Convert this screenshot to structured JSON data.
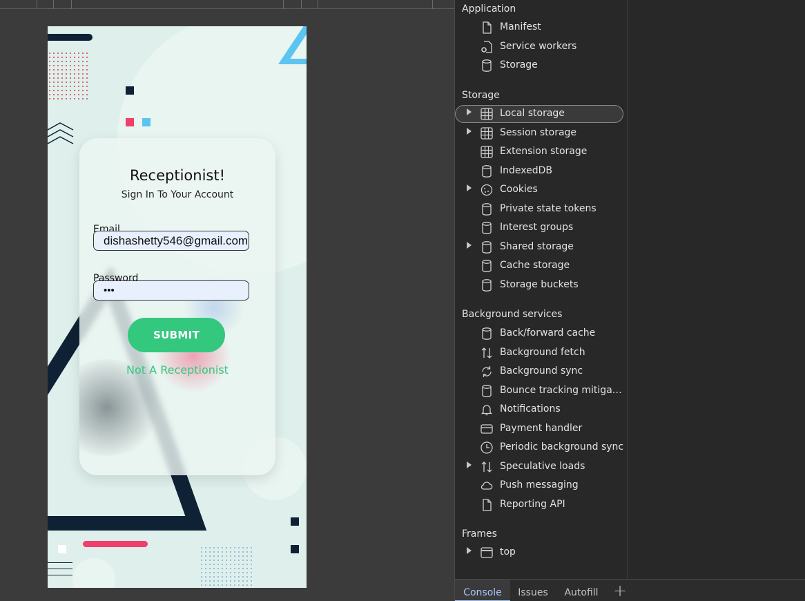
{
  "login_card": {
    "title": "Receptionist!",
    "subtitle": "Sign In To Your Account",
    "email_label": "Email",
    "email_value": "dishashetty546@gmail.com",
    "password_label": "Password",
    "password_value": "•••",
    "submit_label": "SUBMIT",
    "alt_link": "Not A Receptionist"
  },
  "colors": {
    "accent_green": "#33c87e",
    "navy": "#0f2235",
    "pink": "#ef3f6a",
    "sky": "#5bc4ef",
    "devtools_bg": "#282828"
  },
  "devtools": {
    "sections": {
      "application": "Application",
      "storage": "Storage",
      "background_services": "Background services",
      "frames": "Frames"
    },
    "application_items": [
      {
        "label": "Manifest",
        "icon": "file-icon"
      },
      {
        "label": "Service workers",
        "icon": "gear-file-icon"
      },
      {
        "label": "Storage",
        "icon": "database-icon"
      }
    ],
    "storage_items": [
      {
        "label": "Local storage",
        "icon": "grid-icon",
        "expandable": true,
        "selected": true
      },
      {
        "label": "Session storage",
        "icon": "grid-icon",
        "expandable": true
      },
      {
        "label": "Extension storage",
        "icon": "grid-icon"
      },
      {
        "label": "IndexedDB",
        "icon": "database-icon"
      },
      {
        "label": "Cookies",
        "icon": "cookie-icon",
        "expandable": true
      },
      {
        "label": "Private state tokens",
        "icon": "database-icon"
      },
      {
        "label": "Interest groups",
        "icon": "database-icon"
      },
      {
        "label": "Shared storage",
        "icon": "database-icon",
        "expandable": true
      },
      {
        "label": "Cache storage",
        "icon": "database-icon"
      },
      {
        "label": "Storage buckets",
        "icon": "database-icon"
      }
    ],
    "background_items": [
      {
        "label": "Back/forward cache",
        "icon": "database-icon"
      },
      {
        "label": "Background fetch",
        "icon": "up-down-arrows-icon"
      },
      {
        "label": "Background sync",
        "icon": "sync-icon"
      },
      {
        "label": "Bounce tracking mitigati...",
        "icon": "database-icon"
      },
      {
        "label": "Notifications",
        "icon": "bell-icon"
      },
      {
        "label": "Payment handler",
        "icon": "card-icon"
      },
      {
        "label": "Periodic background sync",
        "icon": "clock-icon"
      },
      {
        "label": "Speculative loads",
        "icon": "up-down-arrows-icon",
        "expandable": true
      },
      {
        "label": "Push messaging",
        "icon": "cloud-icon"
      },
      {
        "label": "Reporting API",
        "icon": "file-icon"
      }
    ],
    "frames_items": [
      {
        "label": "top",
        "icon": "window-icon",
        "expandable": true
      }
    ],
    "bottom_tabs": [
      "Console",
      "Issues",
      "Autofill"
    ],
    "active_tab": "Console",
    "add_tab_glyph": "+"
  }
}
